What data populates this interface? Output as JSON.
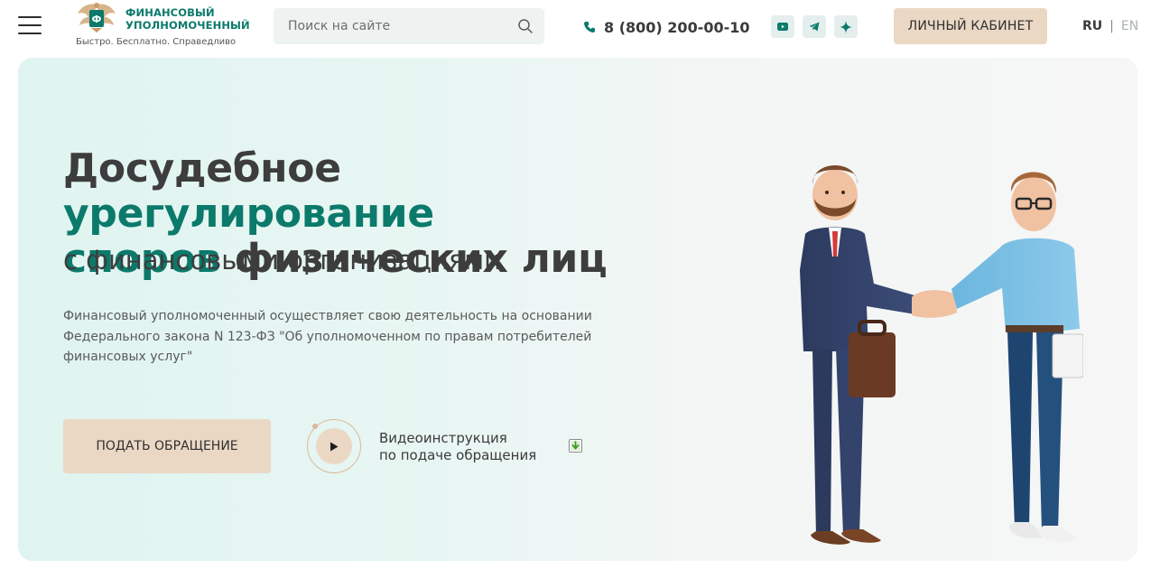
{
  "header": {
    "logo_title_line1": "ФИНАНСОВЫЙ",
    "logo_title_line2": "УПОЛНОМОЧЕННЫЙ",
    "logo_slogan": "Быстро. Бесплатно. Справедливо",
    "search_placeholder": "Поиск на сайте",
    "phone": "8 (800) 200-00-10",
    "socials": [
      "youtube-icon",
      "telegram-icon",
      "sparkle-icon"
    ],
    "cabinet_label": "ЛИЧНЫЙ КАБИНЕТ",
    "lang_ru": "RU",
    "lang_sep": "|",
    "lang_en": "EN"
  },
  "hero": {
    "title_part1": "Досудебное ",
    "title_accent1": "урегулирование",
    "title_accent2": "споров",
    "title_part2": " физических лиц",
    "subtitle": "с финансовыми организациями",
    "description": "Финансовый уполномоченный осуществляет свою деятельность на основании Федерального закона N 123-ФЗ \"Об уполномоченном по правам потребителей финансовых услуг\"",
    "submit_label": "ПОДАТЬ ОБРАЩЕНИЕ",
    "video_line1": "Видеоинструкция",
    "video_line2": "по подаче обращения"
  },
  "colors": {
    "accent": "#0b7a6b",
    "button_bg": "#ead8c5",
    "hero_bg": "#e3f5f1"
  }
}
